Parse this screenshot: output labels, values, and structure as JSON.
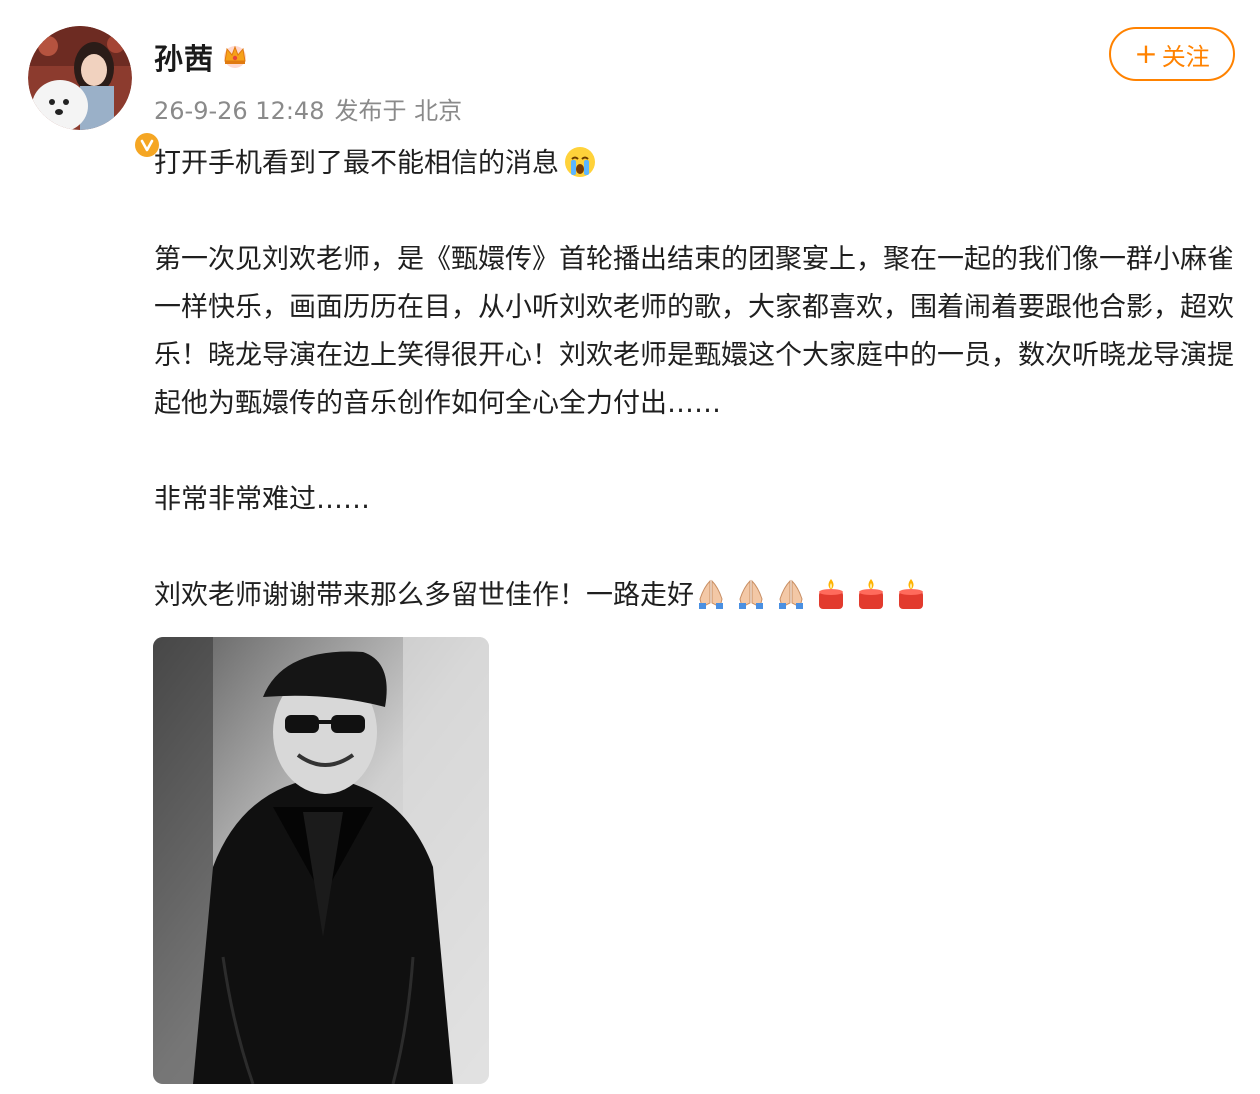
{
  "post": {
    "author": {
      "name": "孙茜",
      "avatar_icon": "avatar-photo",
      "verified_badge_icon": "verified-v-icon",
      "vip_icon": "crown-icon"
    },
    "timestamp": "26-9-26 12:48",
    "source": "发布于 北京",
    "follow_button": {
      "plus": "+",
      "label": "关注"
    },
    "paragraphs": {
      "p1": "打开手机看到了最不能相信的消息",
      "p2": "第一次见刘欢老师，是《甄嬛传》首轮播出结束的团聚宴上，聚在一起的我们像一群小麻雀一样快乐，画面历历在目，从小听刘欢老师的歌，大家都喜欢，围着闹着要跟他合影，超欢乐！晓龙导演在边上笑得很开心！刘欢老师是甄嬛这个大家庭中的一员，数次听晓龙导演提起他为甄嬛传的音乐创作如何全心全力付出……",
      "p3": "非常非常难过……",
      "p4": "刘欢老师谢谢带来那么多留世佳作！一路走好"
    },
    "emoji": {
      "after_p1": "crying-face-icon",
      "after_p4": [
        "praying-hands-icon",
        "praying-hands-icon",
        "praying-hands-icon",
        "candle-icon",
        "candle-icon",
        "candle-icon"
      ]
    },
    "image": {
      "kind": "black-and-white portrait photo"
    },
    "colors": {
      "accent": "#ff8200",
      "verified": "#f5a623",
      "meta_text": "#8a8a8a"
    }
  }
}
